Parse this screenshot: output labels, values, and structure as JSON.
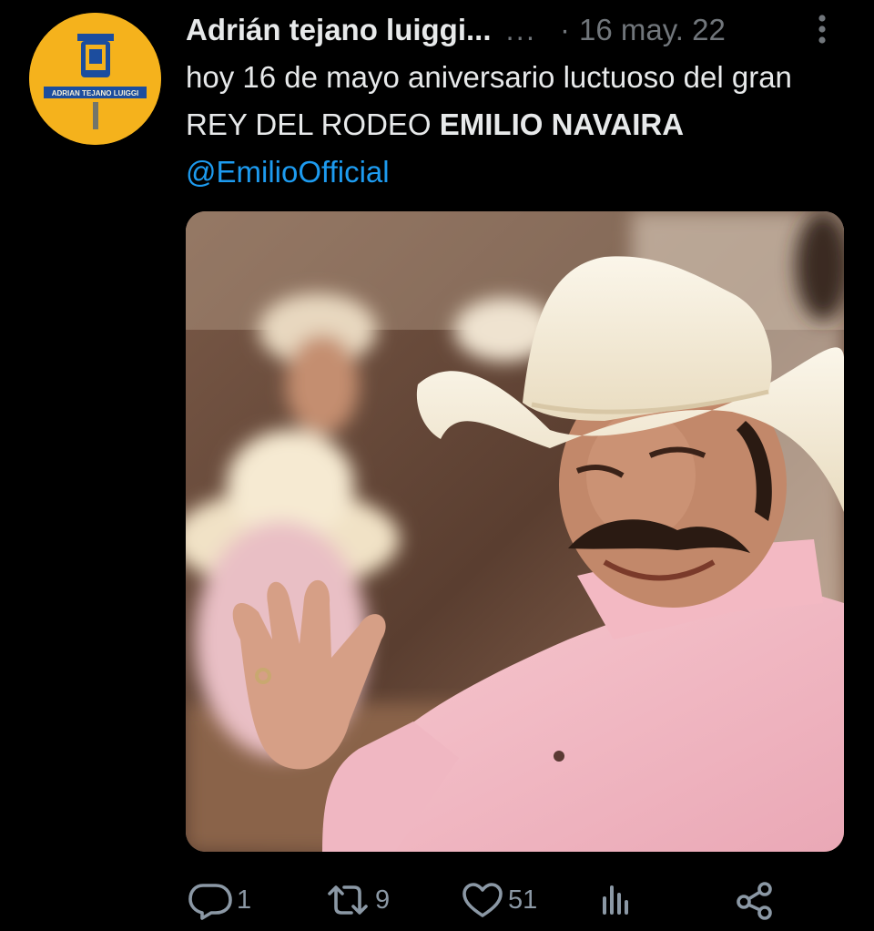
{
  "tweet": {
    "author": {
      "display_name": "Adrián tejano luiggi...",
      "handle_truncated": "...",
      "avatar_text": "ADRIAN TEJANO LUIGGI"
    },
    "separator": "·",
    "timestamp": "16 may. 22",
    "text": {
      "line_part1": "hoy 16 de mayo aniversario luctuoso del gran REY DEL RODEO ",
      "bold_name": "EMILIO NAVAIRA",
      "space": " ",
      "mention": "@EmilioOfficial"
    },
    "media": {
      "description_icon": "photo"
    },
    "actions": {
      "reply_count": "1",
      "retweet_count": "9",
      "like_count": "51",
      "views_count": "",
      "share_count": ""
    }
  },
  "colors": {
    "background": "#000000",
    "text_primary": "#e7e9ea",
    "text_secondary": "#71767b",
    "link": "#1d9bf0",
    "avatar_bg": "#f5b21c"
  },
  "icons": {
    "reply": "reply-icon",
    "retweet": "retweet-icon",
    "like": "heart-icon",
    "views": "views-icon",
    "share": "share-icon",
    "more": "more-icon"
  }
}
